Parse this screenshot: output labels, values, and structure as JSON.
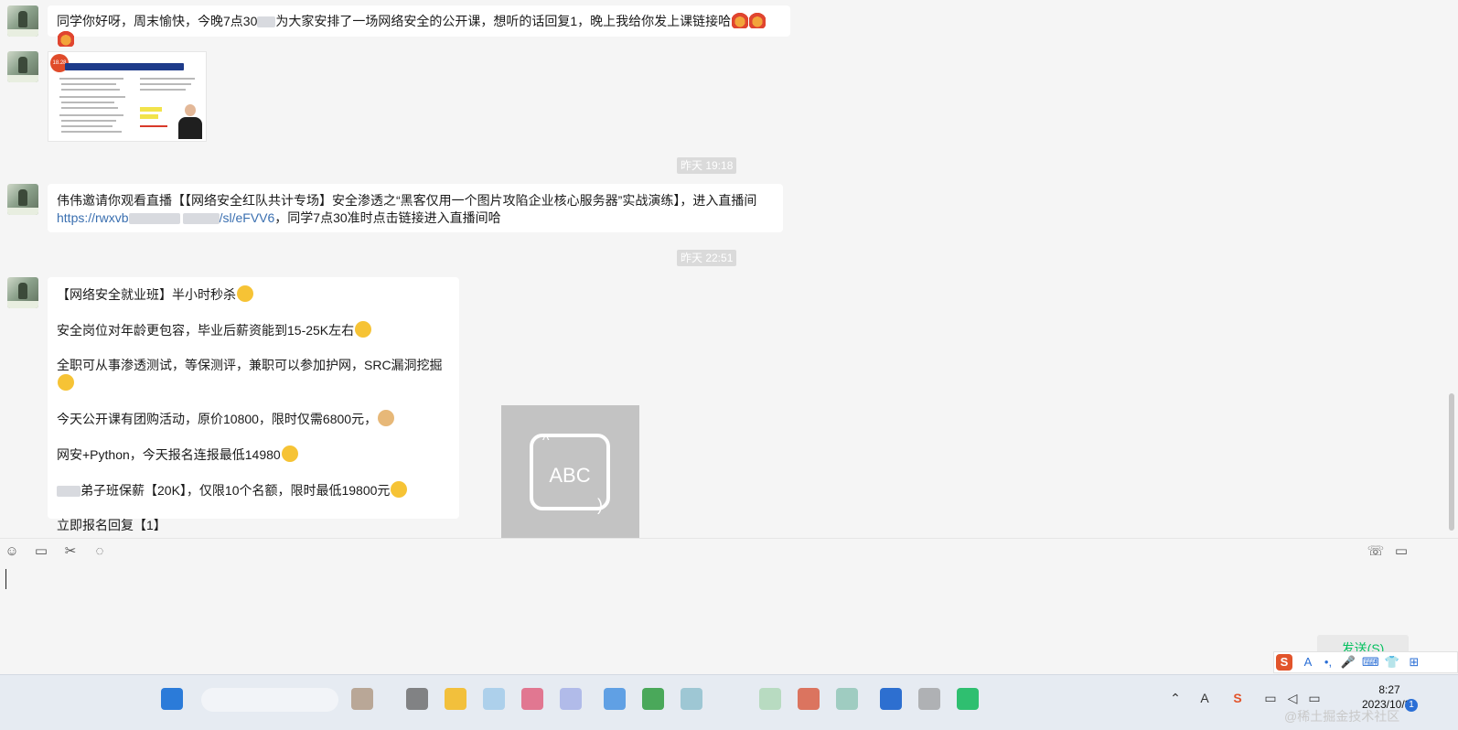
{
  "messages": [
    {
      "kind": "text",
      "text": "同学你好呀，周末愉快，今晚7点30",
      "text_after_blur": "为大家安排了一场网络安全的公开课，想听的话回复1，晚上我给你发上课链接哈"
    },
    {
      "kind": "image",
      "badge": "18.28"
    },
    {
      "kind": "timestamp",
      "text": "昨天 19:18"
    },
    {
      "kind": "text",
      "line1": "伟伟邀请你观看直播【【网络安全红队共计专场】安全渗透之“黑客仅用一个图片攻陷企业核心服务器”实战演练】，进入直播间",
      "link_prefix": "https://rwxvb",
      "link_suffix": "/sl/eFVV6",
      "line2_after": "，同学7点30准时点击链接进入直播间哈"
    },
    {
      "kind": "timestamp",
      "text": "昨天 22:51"
    },
    {
      "kind": "text",
      "paragraphs": [
        "【网络安全就业班】半小时秒杀",
        "安全岗位对年龄更包容，毕业后薪资能到15-25K左右",
        "全职可从事渗透测试，等保测评，兼职可以参加护网，SRC漏洞挖掘",
        "今天公开课有团购活动，原价10800，限时仅需6800元，",
        "网安+Python，今天报名连报最低14980",
        "弟子班保薪【20K】，仅限10个名额，限时最低19800元",
        "立即报名回复【1】"
      ]
    }
  ],
  "ime_overlay": {
    "label": "ABC"
  },
  "toolbar": {
    "icons": [
      "emoji-icon",
      "folder-icon",
      "scissors-icon",
      "chat-history-icon",
      "phone-icon",
      "video-icon"
    ]
  },
  "input": {
    "value": ""
  },
  "send_button": {
    "label": "发送(S)"
  },
  "ime_bar": {
    "items": [
      "S",
      "A",
      "•,",
      "🎤",
      "⌨",
      "👕",
      "⊞"
    ]
  },
  "taskbar": {
    "time": "8:27",
    "date": "2023/10/30",
    "notifications": "1"
  },
  "watermark": "@稀土掘金技术社区",
  "colors": {
    "send_green": "#07c160",
    "link_blue": "#3a6fb0",
    "bubble_white": "#ffffff",
    "background": "#f5f5f5"
  }
}
